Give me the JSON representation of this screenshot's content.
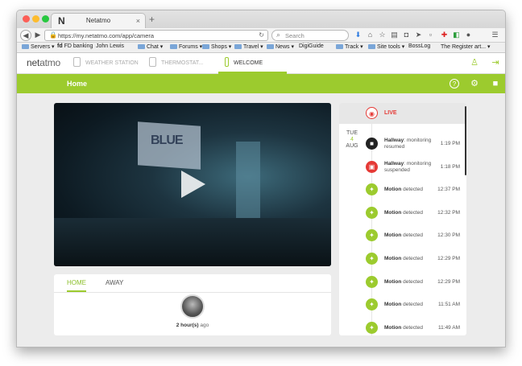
{
  "browser": {
    "tab_letter": "N",
    "tab_title": "Netatmo",
    "tab_close": "×",
    "new_tab": "+",
    "url": "https://my.netatmo.com/app/camera",
    "search_placeholder": "Search"
  },
  "bookmarks": [
    "Servers ▾",
    "FD banking",
    "John Lewis",
    "Chat ▾",
    "Forums ▾",
    "Shops ▾",
    "Travel ▾",
    "News ▾",
    "DigiGuide",
    "Track ▾",
    "Site tools ▾",
    "BossLog",
    "The Register art... ▾"
  ],
  "app": {
    "logo_a": "net",
    "logo_b": "atmo",
    "products": [
      "WEATHER STATION",
      "THERMOSTAT...",
      "WELCOME"
    ],
    "page_title": "Home"
  },
  "presence": {
    "tabs": [
      "HOME",
      "AWAY"
    ],
    "since_value": "2 hour(s)",
    "since_suffix": " ago"
  },
  "events": {
    "live_label": "LIVE",
    "date": {
      "weekday": "TUE",
      "day": "4",
      "month": "AUG"
    },
    "items": [
      {
        "name": "Hallway",
        "action": ": monitoring resumed",
        "time": "1:19 PM",
        "icon": "camera-icon",
        "color": "#222222"
      },
      {
        "name": "Hallway",
        "action": ": monitoring suspended",
        "time": "1:18 PM",
        "icon": "camera-off-icon",
        "color": "#e53935"
      },
      {
        "name": "Motion",
        "action": " detected",
        "time": "12:37 PM",
        "icon": "motion-icon",
        "color": "#9ccb2e"
      },
      {
        "name": "Motion",
        "action": " detected",
        "time": "12:32 PM",
        "icon": "motion-icon",
        "color": "#9ccb2e"
      },
      {
        "name": "Motion",
        "action": " detected",
        "time": "12:30 PM",
        "icon": "motion-icon",
        "color": "#9ccb2e"
      },
      {
        "name": "Motion",
        "action": " detected",
        "time": "12:29 PM",
        "icon": "motion-icon",
        "color": "#9ccb2e"
      },
      {
        "name": "Motion",
        "action": " detected",
        "time": "12:29 PM",
        "icon": "motion-icon",
        "color": "#9ccb2e"
      },
      {
        "name": "Motion",
        "action": " detected",
        "time": "11:51 AM",
        "icon": "motion-icon",
        "color": "#9ccb2e"
      },
      {
        "name": "Motion",
        "action": " detected",
        "time": "11:49 AM",
        "icon": "motion-icon",
        "color": "#9ccb2e"
      }
    ]
  },
  "colors": {
    "accent": "#9ccb2e",
    "alert": "#e53935"
  }
}
